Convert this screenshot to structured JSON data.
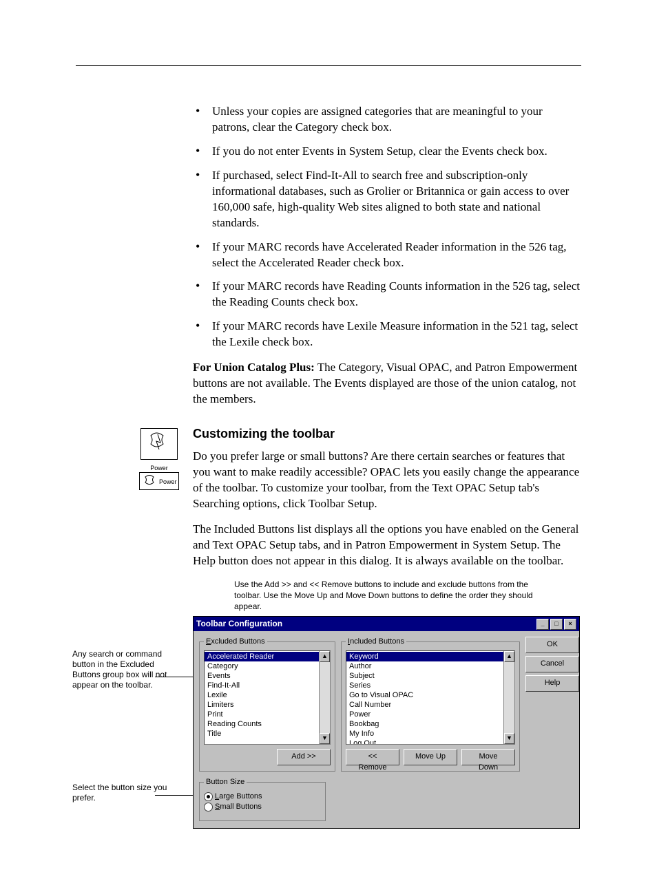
{
  "bullets": [
    "Unless your copies are assigned categories that are meaningful to your patrons, clear the Category check box.",
    "If you do not enter Events in System Setup, clear the Events check box.",
    "If purchased, select Find-It-All to search free and subscription-only informational databases, such as Grolier or Britannica or gain access to over 160,000 safe, high-quality Web sites aligned to both state and national standards.",
    "If your MARC records have Accelerated Reader information in the 526 tag, select the Accelerated Reader check box.",
    "If your MARC records have Reading Counts information in the 526 tag, select the Reading Counts check box.",
    "If your MARC records have Lexile Measure information in the 521 tag, select the Lexile check box."
  ],
  "union_note_label": "For Union Catalog Plus:",
  "union_note_body": " The Category, Visual OPAC, and Patron Empowerment buttons are not available. The Events displayed are those of the union catalog, not the members.",
  "section_heading": "Customizing the toolbar",
  "margin_icon_label": "Power",
  "para1": "Do you prefer large or small buttons? Are there certain searches or features that you want to make readily accessible? OPAC lets you easily change the appearance of the toolbar. To customize your toolbar, from the Text OPAC Setup tab's Searching options, click Toolbar Setup.",
  "para2": "The Included Buttons list displays all the options you have enabled on the General and Text OPAC Setup tabs, and in Patron Empowerment in System Setup. The Help button does not appear in this dialog.  It is always available on the toolbar.",
  "caption": "Use the Add >> and << Remove buttons to include and exclude buttons from the toolbar.  Use the Move Up and Move Down buttons to define the order they should appear.",
  "annot_excluded": "Any search or command button in the Excluded Buttons group box will not appear on the toolbar.",
  "annot_size": "Select the button size you prefer.",
  "dialog": {
    "title": "Toolbar Configuration",
    "excluded_legend": "Excluded Buttons",
    "included_legend": "Included Buttons",
    "excluded_items": [
      "Accelerated Reader",
      "Category",
      "Events",
      "Find-It-All",
      "Lexile",
      "Limiters",
      "Print",
      "Reading Counts",
      "Title"
    ],
    "included_items": [
      "Keyword",
      "Author",
      "Subject",
      "Series",
      "Go to Visual OPAC",
      "Call Number",
      "Power",
      "Bookbag",
      "My Info",
      "Log Out"
    ],
    "btn_add": "Add >>",
    "btn_remove": "<< Remove",
    "btn_moveup": "Move Up",
    "btn_movedown": "Move Down",
    "btn_ok": "OK",
    "btn_cancel": "Cancel",
    "btn_help": "Help",
    "size_legend": "Button Size",
    "radio_large": "Large Buttons",
    "radio_small": "Small Buttons"
  }
}
